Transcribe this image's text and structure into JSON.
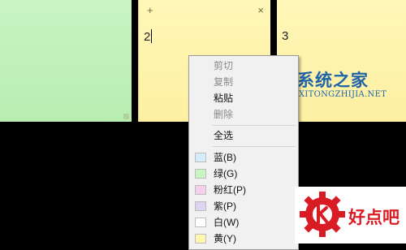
{
  "notes": [
    {
      "id": "green",
      "text": ""
    },
    {
      "id": "yellow-active",
      "text": "2",
      "add_symbol": "+",
      "close_symbol": "×"
    },
    {
      "id": "yellow-3",
      "text": "3"
    }
  ],
  "context_menu": {
    "items": [
      {
        "label": "剪切",
        "enabled": false
      },
      {
        "label": "复制",
        "enabled": false
      },
      {
        "label": "粘贴",
        "enabled": true
      },
      {
        "label": "删除",
        "enabled": false
      },
      {
        "label": "全选",
        "enabled": true
      },
      {
        "label": "蓝(B)",
        "enabled": true,
        "color": "#d6ecfb"
      },
      {
        "label": "绿(G)",
        "enabled": true,
        "color": "#c8f5c2"
      },
      {
        "label": "粉红(P)",
        "enabled": true,
        "color": "#f4cfee"
      },
      {
        "label": "紫(P)",
        "enabled": true,
        "color": "#ddd4f1"
      },
      {
        "label": "白(W)",
        "enabled": true,
        "color": "#ffffff"
      },
      {
        "label": "黄(Y)",
        "enabled": true,
        "color": "#fff6b0"
      }
    ]
  },
  "watermarks": {
    "site_title": "系统之家",
    "site_url": "XITONGZHIJIA.NET",
    "brand2": "好点吧",
    "brand_color": "#1e63a8",
    "brand2_color": "#d91c24"
  }
}
